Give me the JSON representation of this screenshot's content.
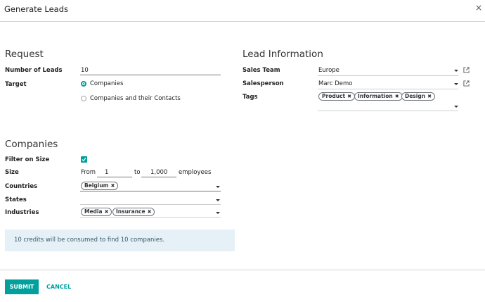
{
  "dialog": {
    "title": "Generate Leads",
    "close_label": "×"
  },
  "request": {
    "section_title": "Request",
    "number_of_leads_label": "Number of Leads",
    "number_of_leads_value": "10",
    "target_label": "Target",
    "target_options": [
      "Companies",
      "Companies and their Contacts"
    ],
    "target_selected": "Companies"
  },
  "lead_info": {
    "section_title": "Lead Information",
    "sales_team_label": "Sales Team",
    "sales_team_value": "Europe",
    "salesperson_label": "Salesperson",
    "salesperson_value": "Marc Demo",
    "tags_label": "Tags",
    "tags": [
      "Product",
      "Information",
      "Design"
    ]
  },
  "companies": {
    "section_title": "Companies",
    "filter_on_size_label": "Filter on Size",
    "filter_on_size_checked": true,
    "size_label": "Size",
    "size_from_label": "From",
    "size_from_value": "1",
    "size_to_label": "to",
    "size_to_value": "1,000",
    "size_unit": "employees",
    "countries_label": "Countries",
    "countries": [
      "Belgium"
    ],
    "states_label": "States",
    "industries_label": "Industries",
    "industries": [
      "Media",
      "Insurance"
    ]
  },
  "alert": {
    "text": "10 credits will be consumed to find 10 companies."
  },
  "footer": {
    "submit_label": "SUBMIT",
    "cancel_label": "CANCEL"
  },
  "colors": {
    "accent": "#00A09D",
    "alert_bg": "#e5f1f7"
  }
}
